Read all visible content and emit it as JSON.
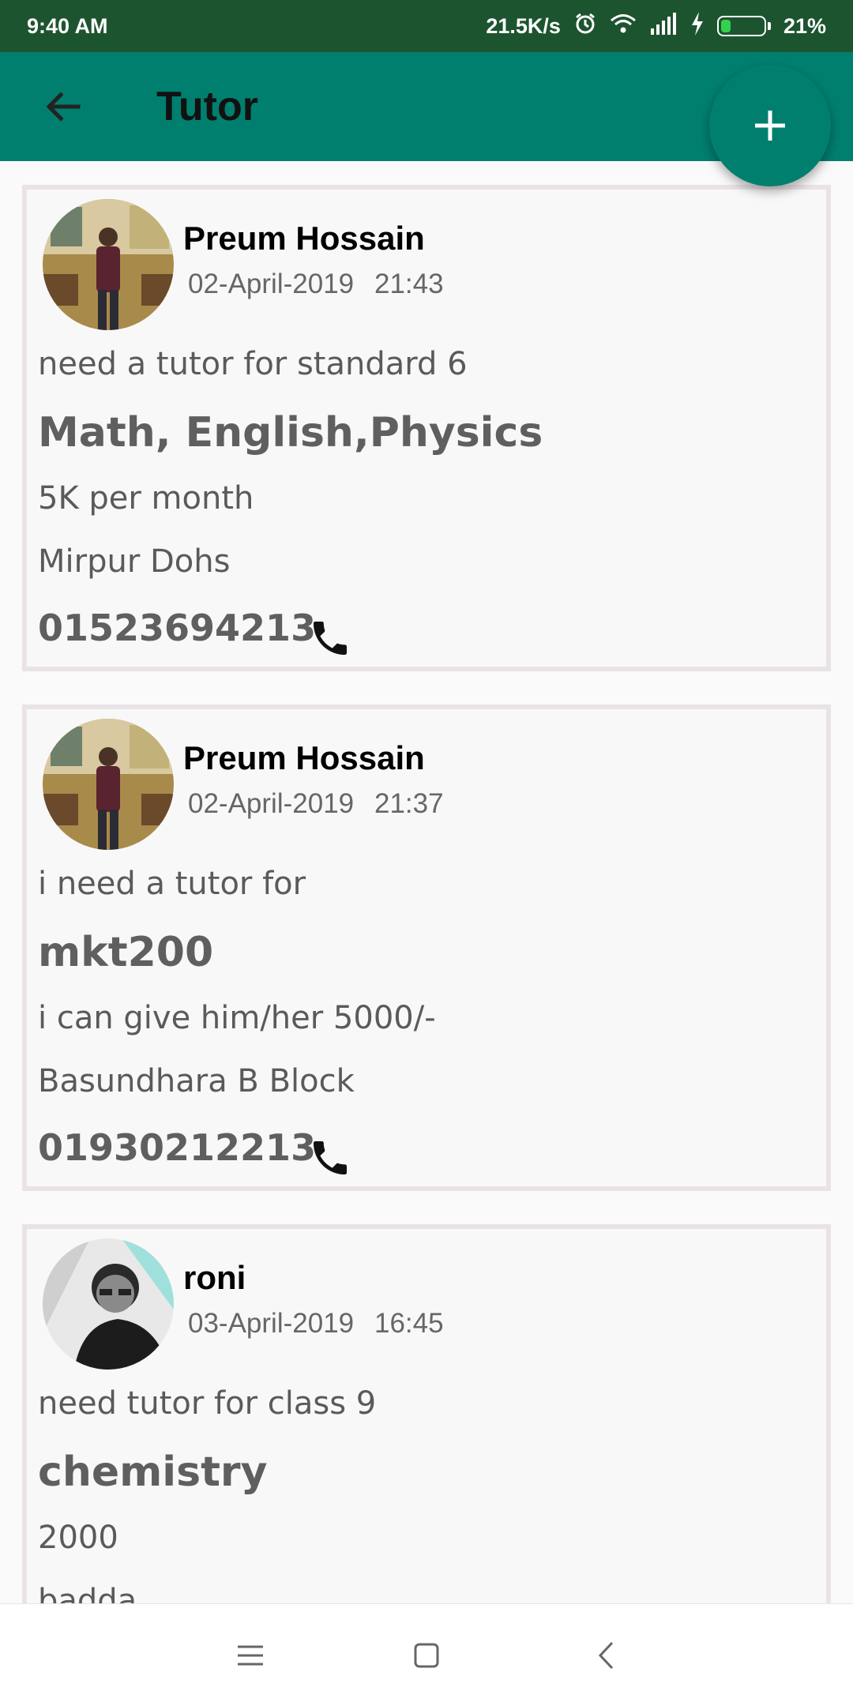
{
  "status_bar": {
    "time": "9:40 AM",
    "net_speed": "21.5K/s",
    "battery_percent": "21%",
    "battery_level": 0.21,
    "icons": [
      "alarm-icon",
      "wifi-icon",
      "signal-icon",
      "charging-icon",
      "battery-icon"
    ]
  },
  "app_bar": {
    "title": "Tutor",
    "back_icon": "back-arrow-icon",
    "fab_icon": "plus-icon"
  },
  "posts": [
    {
      "name": "Preum Hossain",
      "date": "02-April-2019",
      "time": "21:43",
      "description": " need a tutor for standard 6",
      "subject": "Math, English,Physics",
      "salary": "5K per month",
      "location": "Mirpur Dohs",
      "phone": "01523694213"
    },
    {
      "name": "Preum Hossain",
      "date": "02-April-2019",
      "time": "21:37",
      "description": "i need a tutor for",
      "subject": "mkt200",
      "salary": "i can give him/her 5000/-",
      "location": "Basundhara B Block",
      "phone": "01930212213"
    },
    {
      "name": "roni",
      "date": "03-April-2019",
      "time": "16:45",
      "description": "need tutor for class 9",
      "subject": "chemistry",
      "salary": "2000",
      "location": "badda",
      "phone": ""
    }
  ],
  "nav_bar": {
    "icons": [
      "menu-icon",
      "home-icon",
      "back-icon"
    ]
  },
  "colors": {
    "status_bar": "#1d5430",
    "app_bar": "#007f6f",
    "card_border": "#e9e3e6"
  }
}
